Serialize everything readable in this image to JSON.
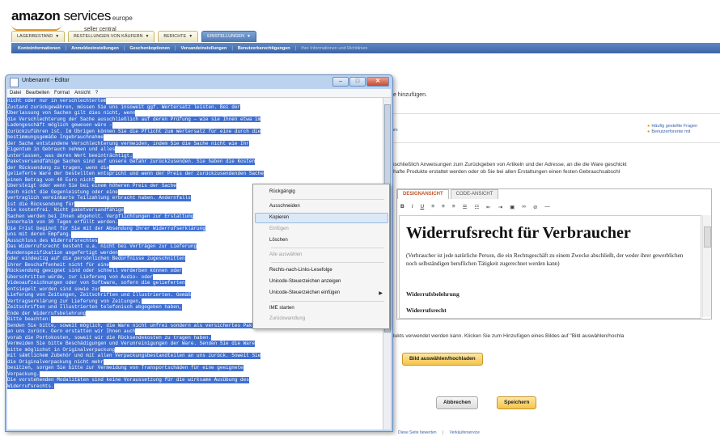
{
  "logo": {
    "brand": "amazon",
    "services": "services",
    "region": "europe",
    "sub": "seller central"
  },
  "tabs": [
    {
      "label": "LAGERBESTAND"
    },
    {
      "label": "BESTELLUNGEN VON KÄUFERN"
    },
    {
      "label": "BERICHTE"
    },
    {
      "label": "EINSTELLUNGEN"
    }
  ],
  "nav": [
    "Kontoinformationen",
    "Anmeldeeinstellungen",
    "Geschenkoptionen",
    "Versandeinstellungen",
    "Benutzerberechtigungen",
    "Ihre Informationen und Richtlinien"
  ],
  "background": {
    "add_text": "te hinzufügen.",
    "left_link": "hm",
    "faq_link": "Häufig gestellte Fragen",
    "forum_link": "Benutzerforente mit",
    "desc_line1": "nschließlich Anweisungen zum Zurückgeben von Artikeln und der Adresse, an die die Ware geschickt",
    "desc_line2": "rhafte Produkte erstattet werden oder ob Sie bei allen Erstattungen einen festen Gebrauchsabschl",
    "image_text": "dukts verwendet werden kann. Klicken Sie zum Hinzufügen eines Bildes auf \"Bild auswählen/hochla",
    "btn_image": "Bild auswählen/hochladen",
    "btn_cancel": "Abbrechen",
    "btn_save": "Speichern",
    "footer_link1": "Diese Seite bewerten",
    "footer_sep": "|",
    "footer_link2": "Verkäuferservice"
  },
  "editor": {
    "tab_design": "DESIGNANSICHT",
    "tab_code": "CODE-ANSICHT",
    "heading": "Widerrufsrecht für Verbraucher",
    "para": "(Verbraucher ist jede natürliche Person, die ein Rechtsgeschäft zu einem Zwecke abschließt, der weder ihrer gewerblichen noch selbständigen beruflichen Tätigkeit zugerechnet werden kann)",
    "bold1": "Widerrufsbelehrung",
    "bold2": "Widerrufsrecht"
  },
  "notepad": {
    "title": "Unbenannt - Editor",
    "menu": [
      "Datei",
      "Bearbeiten",
      "Format",
      "Ansicht",
      "?"
    ],
    "lines": [
      "nicht oder nur in verschlechtertem",
      "Zustand zurückgewähren, müssen Sie uns insoweit ggf. Wertersatz leisten. Bei der",
      "Überlassung von Sachen gilt dies nicht, wenn",
      "die Verschlechterung der Sache ausschließlich auf deren Prüfung – wie sie Ihnen etwa im",
      "Ladengeschäft möglich gewesen wäre –",
      "zurückzuführen ist. Im Übrigen können Sie die Pflicht zum Wertersatz für eine durch die",
      "bestimmungsgemäße Ingebrauchnahme",
      "der Sache entstandene Verschlechterung vermeiden, indem Sie die Sache nicht wie Ihr",
      "Eigentum in Gebrauch nehmen und alles",
      "unterlassen, was deren Wert beeinträchtigt.",
      "Paketversandfähige Sachen sind auf unsere Gefahr zurückzusenden. Sie haben die Kosten",
      "der Rücksendung zu tragen, wenn die",
      "gelieferte Ware der bestellten entspricht und wenn der Preis der zurückzusendenden Sache",
      "einen Betrag von 40 Euro nicht",
      "übersteigt oder wenn Sie bei einem höheren Preis der Sache",
      "noch nicht die Gegenleistung oder eine",
      "vertraglich vereinbarte Teilzahlung erbracht haben. Andernfalls",
      "ist die Rücksendung für",
      "Sie kostenfrei. Nicht paketversandfähige",
      "Sachen werden bei Ihnen abgeholt. Verpflichtungen zur Erstattung",
      "innerhalb von 30 Tagen erfüllt werden.",
      "Die Frist beginnt für Sie mit der Absendung Ihrer Widerrufserklärung",
      "uns mit deren Empfang.",
      "Ausschluss des Widerrufsrechtes",
      "Das Widerrufsrecht besteht u.a. nicht bei Verträgen zur Lieferung",
      "Kundenspezifikation angefertigt werden",
      "oder eindeutig auf die persönlichen Bedürfnisse zugeschnitten",
      "ihrer Beschaffenheit nicht für eine",
      "Rücksendung geeignet sind oder schnell verderben können oder",
      "überschritten würde, zur Lieferung von Audio- oder",
      "Videoaufzeichnungen oder von Software, sofern die gelieferten",
      "entsiegelt worden sind sowie zur",
      "Lieferung von Zeitungen, Zeitschriften und Illustrierten. Gemäß",
      "Vertragserklärung zur Lieferung von Zeitungen,",
      "Zeitschriften und Illustrierten telefonisch abgegeben haben,",
      "Ende der Widerrufsbelehrung",
      "Bitte beachten:",
      "Senden Sie bitte, soweit möglich, die Ware nicht unfrei sondern als versichertes Paket",
      "an uns zurück. Gern erstatten wir Ihnen auch",
      "vorab die Portokosten, soweit wir die Rücksendekosten zu tragen haben.",
      "Vermeiden Sie bitte Beschädigungen und Verunreinigungen der Ware. Senden Sie die Ware",
      "bitte möglichst in Originalverpackung",
      "mit sämtlichem Zubehör und mit allen Verpackungsbestandteilen an uns zurück. Soweit Sie",
      "die Originalverpackung nicht mehr",
      "besitzen, sorgen Sie bitte zur Vermeidung von Transportschäden für eine geeignete",
      "Verpackung.",
      "Die vorstehenden Modalitäten sind keine Voraussetzung für die wirksame Ausübung des",
      "Widerrufsrechts."
    ]
  },
  "context_menu": {
    "items": [
      {
        "label": "Rückgängig",
        "enabled": true
      },
      {
        "label": "Ausschneiden",
        "enabled": true
      },
      {
        "label": "Kopieren",
        "enabled": true,
        "highlighted": true
      },
      {
        "label": "Einfügen",
        "enabled": false
      },
      {
        "label": "Löschen",
        "enabled": true
      },
      {
        "label": "Alle auswählen",
        "enabled": false
      },
      {
        "label": "Rechts-nach-Links-Lesefolge",
        "enabled": true
      },
      {
        "label": "Unicode-Steuerzeichen anzeigen",
        "enabled": true
      },
      {
        "label": "Unicode-Steuerzeichen einfügen",
        "enabled": true,
        "submenu": true
      },
      {
        "label": "IME starten",
        "enabled": true
      },
      {
        "label": "Zurückwandlung",
        "enabled": false
      }
    ]
  },
  "colors": {
    "nav_blue": "#3c64a6",
    "selection": "#3f6fd1",
    "button_yellow": "#f4c44a",
    "accent_orange": "#e69a2b"
  }
}
